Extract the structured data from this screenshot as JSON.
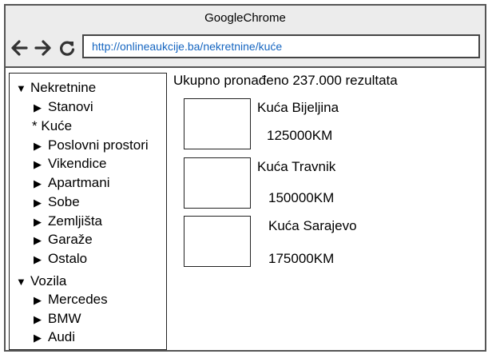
{
  "window": {
    "title": "GoogleChrome"
  },
  "toolbar": {
    "back_icon": "arrow-left",
    "forward_icon": "arrow-right",
    "reload_icon": "reload",
    "url": "http://onlineaukcije.ba/nekretnine/kuće"
  },
  "sidebar": {
    "groups": [
      {
        "label": "Nekretnine",
        "items": [
          "Stanovi",
          "Kuće",
          "Poslovni prostori",
          "Vikendice",
          "Apartmani",
          "Sobe",
          "Zemljišta",
          "Garaže",
          "Ostalo"
        ],
        "selected": "Kuće"
      },
      {
        "label": "Vozila",
        "items": [
          "Mercedes",
          "BMW",
          "Audi"
        ]
      }
    ],
    "selected_marker": "*",
    "expanded_marker": "▼",
    "collapsed_marker": "▶"
  },
  "main": {
    "summary": "Ukupno pronađeno 237.000 rezultata",
    "results": [
      {
        "title": "Kuća Bijeljina",
        "price": "125000KM"
      },
      {
        "title": "Kuća Travnik",
        "price": "150000KM"
      },
      {
        "title": "Kuća Sarajevo",
        "price": "175000KM"
      }
    ]
  }
}
